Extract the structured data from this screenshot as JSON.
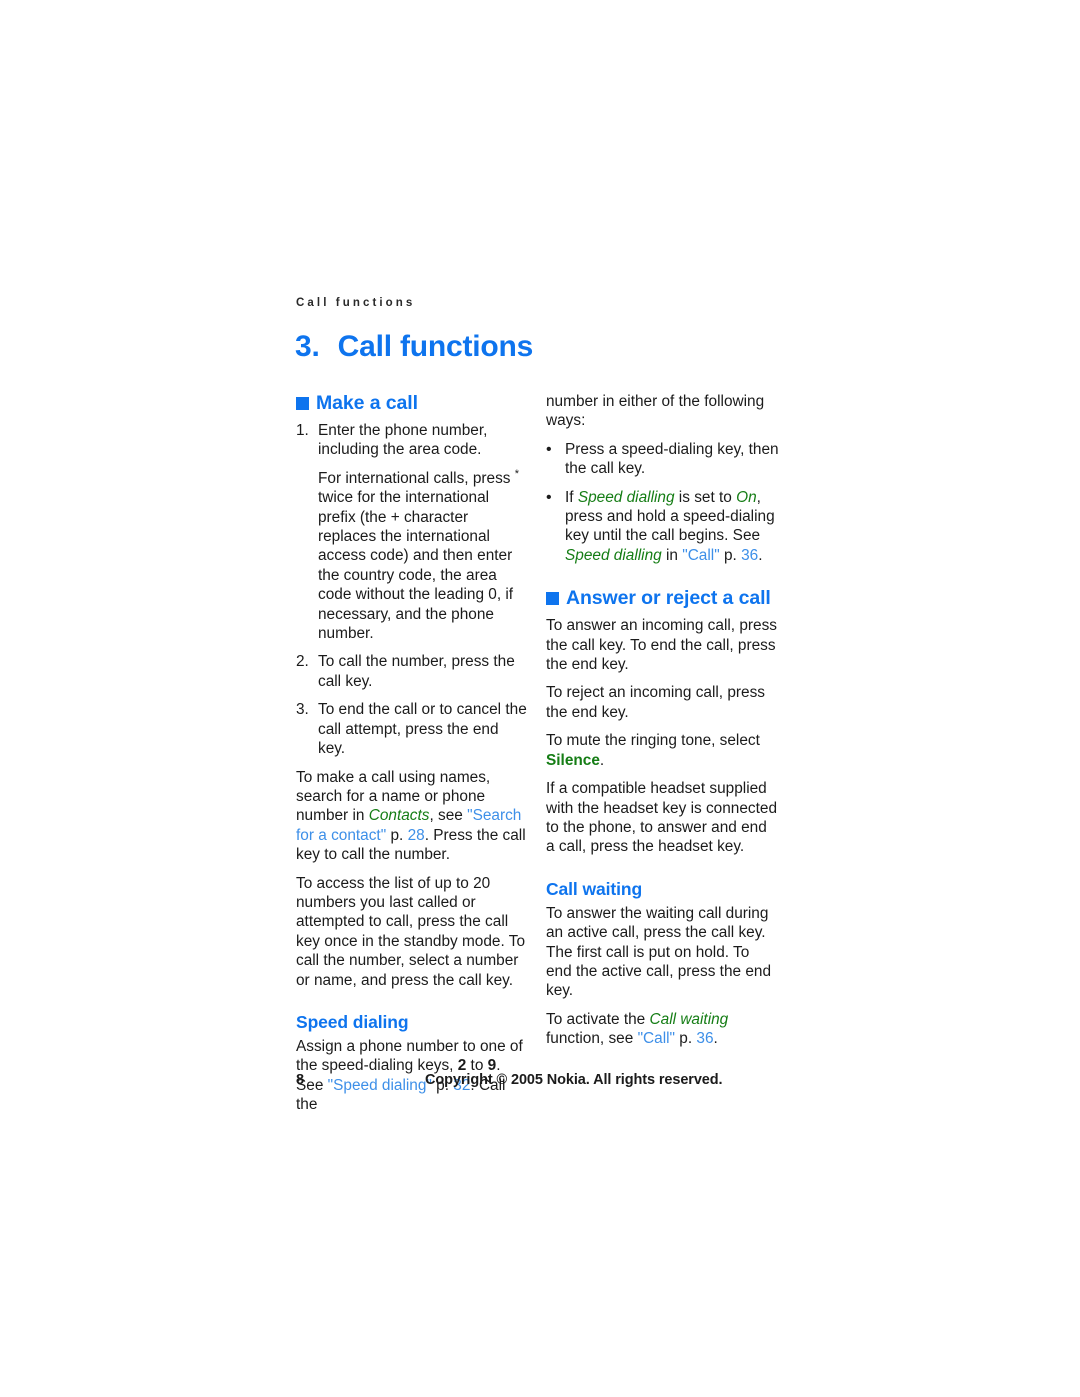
{
  "document": {
    "running_header": "Call functions",
    "chapter_number": "3.",
    "chapter_title": "Call functions",
    "page_number": "8",
    "copyright": "Copyright © 2005 Nokia. All rights reserved.",
    "colors": {
      "heading_blue": "#0E74EE",
      "ui_green": "#157D15",
      "crossref_blue": "#3D8FE8",
      "body_text": "#1b1b1b",
      "page_background": "#ffffff"
    }
  },
  "left_column": {
    "section_heading": "Make a call",
    "steps": [
      {
        "number": "1.",
        "paragraphs": [
          "Enter the phone number, including the area code.",
          "For international calls, press "
        ],
        "star": "*",
        "continued": "twice for the international prefix (the + character replaces the international access code) and then enter the country code, the area code without the leading 0, if necessary, and the phone number."
      },
      {
        "number": "2.",
        "paragraphs": [
          "To call the number, press the call key."
        ]
      },
      {
        "number": "3.",
        "paragraphs": [
          "To end the call or to cancel the call attempt, press the end key."
        ]
      }
    ],
    "para_search": {
      "part1": "To make a call using names, search for a name or phone number in ",
      "ui_contacts": "Contacts",
      "part2": ", see ",
      "xref": "\"Search for a contact\"",
      "part3": " p. ",
      "pagenum": "28",
      "part4": ". Press the call key to call the number."
    },
    "para_recent": "To access the list of up to 20 numbers you last called or attempted to call, press the call key once in the standby mode. To call the number, select a number or name, and press the call key.",
    "subsection_heading": "Speed dialing",
    "para_speed": {
      "part1": "Assign a phone number to one of the speed-dialing keys, ",
      "key_from": "2",
      "part2": " to ",
      "key_to": "9",
      "part3": ". See ",
      "xref": "\"Speed dialing\"",
      "part4": " p. ",
      "pagenum": "32",
      "part5": ". Call the "
    }
  },
  "right_column": {
    "para_continued": "number in either of the following ways:",
    "bullets": [
      {
        "text": "Press a speed-dialing key, then the call key."
      },
      {
        "part1": "If ",
        "ui1": "Speed dialling",
        "part2": " is set to ",
        "ui2": "On",
        "part3": ", press and hold a speed-dialing key until the call begins. See ",
        "ui3": "Speed dialling",
        "part4": " in ",
        "xref": "\"Call\"",
        "part5": " p. ",
        "pagenum": "36",
        "part6": "."
      }
    ],
    "section_heading": "Answer or reject a call",
    "para_answer": "To answer an incoming call, press the call key. To end the call, press the end key.",
    "para_reject": "To reject an incoming call, press the end key.",
    "para_mute": {
      "part1": "To mute the ringing tone, select ",
      "ui_silence": "Silence",
      "part2": "."
    },
    "para_headset": "If a compatible headset supplied with the headset key is connected to the phone, to answer and end a call, press the headset key.",
    "subsection_heading": "Call waiting",
    "para_waiting": "To answer the waiting call during an active call, press the call key. The first call is put on hold. To end the active call, press the end key.",
    "para_activate": {
      "part1": "To activate the ",
      "ui_callwaiting": "Call waiting",
      "part2": " function, see ",
      "xref": "\"Call\"",
      "part3": " p. ",
      "pagenum": "36",
      "part4": "."
    }
  }
}
